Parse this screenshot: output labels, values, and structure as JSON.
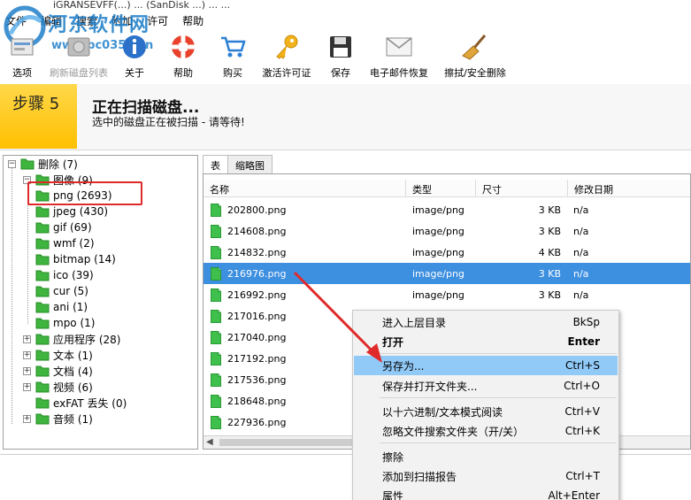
{
  "window": {
    "title": "iGRANSEVFF(...) ... (SanDisk ...) ... ..."
  },
  "watermark": {
    "site_name": "河东软件网",
    "url": "www.pc0359.cn"
  },
  "menu": [
    "文件",
    "编辑",
    "搜索",
    "附加",
    "许可",
    "帮助"
  ],
  "toolbar": [
    {
      "label": "选项",
      "icon": "options-icon",
      "enabled": true
    },
    {
      "label": "刷新磁盘列表",
      "icon": "refresh-disk-icon",
      "enabled": false
    },
    {
      "label": "关于",
      "icon": "info-icon",
      "enabled": true
    },
    {
      "label": "帮助",
      "icon": "lifebuoy-icon",
      "enabled": true
    },
    {
      "label": "购买",
      "icon": "cart-icon",
      "enabled": true
    },
    {
      "label": "激活许可证",
      "icon": "key-icon",
      "enabled": true
    },
    {
      "label": "保存",
      "icon": "floppy-icon",
      "enabled": true
    },
    {
      "label": "电子邮件恢复",
      "icon": "envelope-icon",
      "enabled": true
    },
    {
      "label": "擦拭/安全删除",
      "icon": "broom-icon",
      "enabled": true
    }
  ],
  "step": {
    "label": "步骤 5",
    "title": "正在扫描磁盘...",
    "subtitle": "选中的磁盘正在被扫描 - 请等待!"
  },
  "tree": [
    {
      "label": "删除 (7)",
      "level": 0,
      "expander": "-"
    },
    {
      "label": "图像 (9)",
      "level": 1,
      "expander": "-"
    },
    {
      "label": "png (2693)",
      "level": 2,
      "expander": ""
    },
    {
      "label": "jpeg (430)",
      "level": 2,
      "expander": ""
    },
    {
      "label": "gif (69)",
      "level": 2,
      "expander": ""
    },
    {
      "label": "wmf (2)",
      "level": 2,
      "expander": ""
    },
    {
      "label": "bitmap (14)",
      "level": 2,
      "expander": ""
    },
    {
      "label": "ico (39)",
      "level": 2,
      "expander": ""
    },
    {
      "label": "cur (5)",
      "level": 2,
      "expander": ""
    },
    {
      "label": "ani (1)",
      "level": 2,
      "expander": ""
    },
    {
      "label": "mpo (1)",
      "level": 2,
      "expander": ""
    },
    {
      "label": "应用程序 (28)",
      "level": 1,
      "expander": "+"
    },
    {
      "label": "文本 (1)",
      "level": 1,
      "expander": "+"
    },
    {
      "label": "文档 (4)",
      "level": 1,
      "expander": "+"
    },
    {
      "label": "视频 (6)",
      "level": 1,
      "expander": "+"
    },
    {
      "label": "exFAT 丢失 (0)",
      "level": 1,
      "expander": ""
    },
    {
      "label": "音频 (1)",
      "level": 1,
      "expander": "+"
    }
  ],
  "tabs": [
    "表",
    "缩略图"
  ],
  "columns": [
    "名称",
    "类型",
    "尺寸",
    "修改日期"
  ],
  "files": [
    {
      "name": "202800.png",
      "type": "image/png",
      "size": "3 KB",
      "date": "n/a",
      "selected": false
    },
    {
      "name": "214608.png",
      "type": "image/png",
      "size": "3 KB",
      "date": "n/a",
      "selected": false
    },
    {
      "name": "214832.png",
      "type": "image/png",
      "size": "4 KB",
      "date": "n/a",
      "selected": false
    },
    {
      "name": "216976.png",
      "type": "image/png",
      "size": "3 KB",
      "date": "n/a",
      "selected": true
    },
    {
      "name": "216992.png",
      "type": "image/png",
      "size": "3 KB",
      "date": "n/a",
      "selected": false
    },
    {
      "name": "217016.png",
      "type": "",
      "size": "",
      "date": "",
      "selected": false
    },
    {
      "name": "217040.png",
      "type": "",
      "size": "",
      "date": "",
      "selected": false
    },
    {
      "name": "217192.png",
      "type": "",
      "size": "",
      "date": "",
      "selected": false
    },
    {
      "name": "217536.png",
      "type": "",
      "size": "",
      "date": "",
      "selected": false
    },
    {
      "name": "218648.png",
      "type": "",
      "size": "",
      "date": "",
      "selected": false
    },
    {
      "name": "227936.png",
      "type": "",
      "size": "",
      "date": "",
      "selected": false
    }
  ],
  "context_menu": [
    {
      "label": "进入上层目录",
      "shortcut": "BkSp",
      "bold": false,
      "highlighted": false
    },
    {
      "label": "打开",
      "shortcut": "Enter",
      "bold": true,
      "highlighted": false
    },
    {
      "label": "另存为...",
      "shortcut": "Ctrl+S",
      "bold": false,
      "highlighted": true
    },
    {
      "label": "保存并打开文件夹...",
      "shortcut": "Ctrl+O",
      "bold": false,
      "highlighted": false
    },
    {
      "label": "以十六进制/文本模式阅读",
      "shortcut": "Ctrl+V",
      "bold": false,
      "highlighted": false
    },
    {
      "label": "忽略文件搜索文件夹（开/关）",
      "shortcut": "Ctrl+K",
      "bold": false,
      "highlighted": false
    },
    {
      "label": "擦除",
      "shortcut": "",
      "bold": false,
      "highlighted": false
    },
    {
      "label": "添加到扫描报告",
      "shortcut": "Ctrl+T",
      "bold": false,
      "highlighted": false
    },
    {
      "label": "属性",
      "shortcut": "Alt+Enter",
      "bold": false,
      "highlighted": false
    }
  ],
  "colors": {
    "selection": "#3d8fe0",
    "menu_highlight": "#91c9f7",
    "step_yellow": "#ffc000",
    "annotation_red": "#e02a2a",
    "folder_green": "#3fb53f"
  }
}
